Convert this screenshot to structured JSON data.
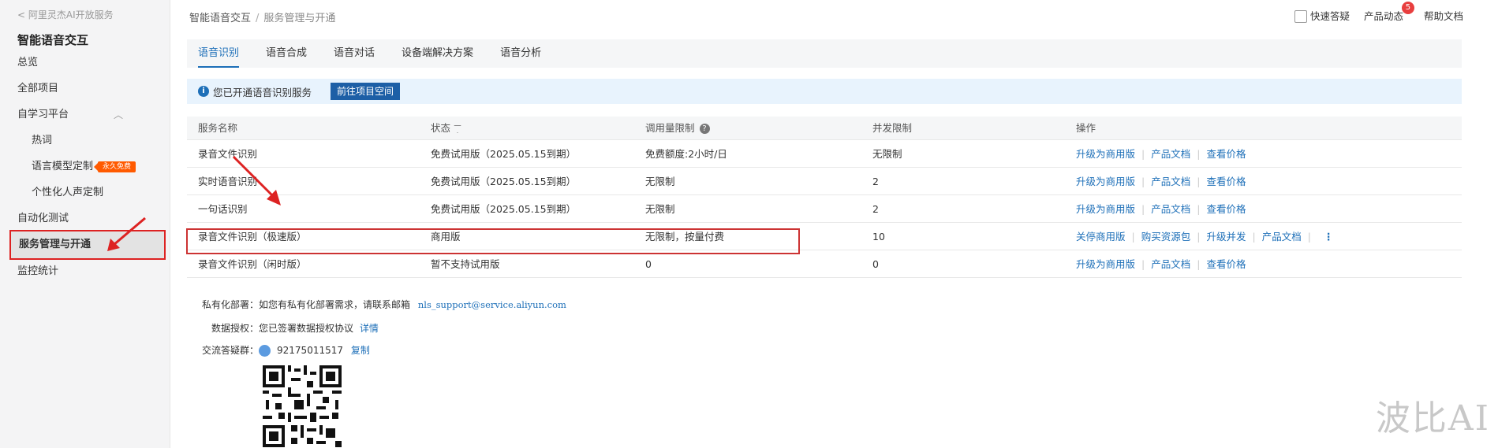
{
  "sidebar": {
    "back_link": "< 阿里灵杰AI开放服务",
    "title": "智能语音交互",
    "items": [
      {
        "label": "总览"
      },
      {
        "label": "全部项目"
      },
      {
        "label": "自学习平台"
      },
      {
        "label": "热词"
      },
      {
        "label": "语言模型定制",
        "badge": "永久免费"
      },
      {
        "label": "个性化人声定制"
      },
      {
        "label": "自动化测试"
      },
      {
        "label": "服务管理与开通"
      },
      {
        "label": "监控统计"
      }
    ]
  },
  "header": {
    "breadcrumb_root": "智能语音交互",
    "breadcrumb_sep": "/",
    "breadcrumb_current": "服务管理与开通",
    "quick_qa": "快速答疑",
    "product_news": "产品动态",
    "news_count": "5",
    "help_docs": "帮助文档"
  },
  "tabs": [
    "语音识别",
    "语音合成",
    "语音对话",
    "设备端解决方案",
    "语音分析"
  ],
  "notice": {
    "text": "您已开通语音识别服务",
    "button": "前往项目空间"
  },
  "table": {
    "headers": [
      "服务名称",
      "状态",
      "调用量限制",
      "并发限制",
      "操作"
    ],
    "rows": [
      {
        "name": "录音文件识别",
        "status": "免费试用版（2025.05.15到期）",
        "limit": "免费额度:2小时/日",
        "concurrency": "无限制",
        "actions": [
          "升级为商用版",
          "产品文档",
          "查看价格"
        ]
      },
      {
        "name": "实时语音识别",
        "status": "免费试用版（2025.05.15到期）",
        "limit": "无限制",
        "concurrency": "2",
        "actions": [
          "升级为商用版",
          "产品文档",
          "查看价格"
        ]
      },
      {
        "name": "一句话识别",
        "status": "免费试用版（2025.05.15到期）",
        "limit": "无限制",
        "concurrency": "2",
        "actions": [
          "升级为商用版",
          "产品文档",
          "查看价格"
        ]
      },
      {
        "name": "录音文件识别（极速版）",
        "status": "商用版",
        "limit": "无限制，按量付费",
        "concurrency": "10",
        "actions": [
          "关停商用版",
          "购买资源包",
          "升级并发",
          "产品文档"
        ]
      },
      {
        "name": "录音文件识别（闲时版）",
        "status": "暂不支持试用版",
        "limit": "0",
        "concurrency": "0",
        "actions": [
          "升级为商用版",
          "产品文档",
          "查看价格"
        ]
      }
    ]
  },
  "info": {
    "private_label": "私有化部署：",
    "private_text": "如您有私有化部署需求，请联系邮箱",
    "private_email": "nls_support@service.aliyun.com",
    "auth_label": "数据授权：",
    "auth_text": "您已签署数据授权协议",
    "auth_link": "详情",
    "group_label": "交流答疑群：",
    "group_number": "92175011517",
    "copy_link": "复制"
  },
  "watermark": "波比AI",
  "colors": {
    "accent": "#1d6fb8",
    "highlight": "#cc2222",
    "badge": "#ff5a00"
  }
}
